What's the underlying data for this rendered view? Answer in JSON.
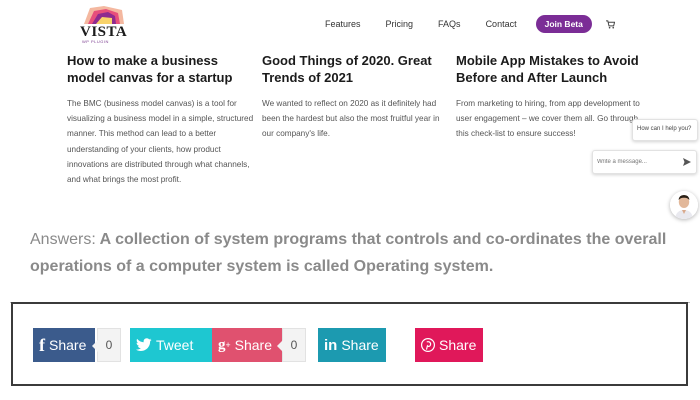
{
  "logo": {
    "name": "VISTA",
    "sub": "WP PLUGIN"
  },
  "nav": {
    "links": [
      "Features",
      "Pricing",
      "FAQs",
      "Contact"
    ],
    "cta": "Join Beta"
  },
  "cards": [
    {
      "title": "How to make a business model canvas for a startup",
      "desc": "The BMC (business model canvas) is a tool for visualizing a business model in a simple, structured manner. This method can lead to a better understanding of your clients, how product innovations are distributed through what channels, and what brings the most profit."
    },
    {
      "title": "Good Things of 2020. Great Trends of 2021",
      "desc": "We wanted to reflect on 2020 as it definitely had been the hardest but also the most fruitful year in our company's life."
    },
    {
      "title": "Mobile App Mistakes to Avoid Before and After Launch",
      "desc": "From marketing to hiring, from app development to user engagement – we cover them all. Go through this check-list to ensure success!"
    }
  ],
  "chat": {
    "bubble": "How can I help you?",
    "placeholder": "Write a message..."
  },
  "answer": {
    "prefix": "Answers:",
    "text": "A collection of system programs that controls and co-ordinates the overall operations of a computer system is called Operating system."
  },
  "share": {
    "facebook": {
      "label": "Share",
      "count": "0",
      "icon": "f",
      "color": "#3b5b8c"
    },
    "twitter": {
      "label": "Tweet",
      "icon": "twitter-bird",
      "color": "#1ec7d1"
    },
    "googleplus": {
      "label": "Share",
      "count": "0",
      "icon": "g+",
      "color": "#e0516f"
    },
    "linkedin": {
      "label": "Share",
      "icon": "in",
      "color": "#1c9ab0"
    },
    "pinterest": {
      "label": "Share",
      "icon": "pinterest-p",
      "color": "#e0185a"
    }
  }
}
